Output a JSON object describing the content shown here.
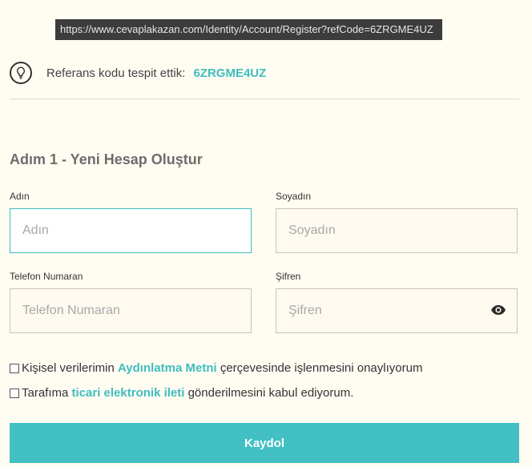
{
  "browser": {
    "url": "https://www.cevaplakazan.com/Identity/Account/Register?refCode=6ZRGME4UZ"
  },
  "referral": {
    "label": "Referans kodu tespit ettik:",
    "code": "6ZRGME4UZ",
    "icon": "lightbulb-icon"
  },
  "form": {
    "step_title": "Adım 1 - Yeni Hesap Oluştur",
    "first_name": {
      "label": "Adın",
      "placeholder": "Adın",
      "value": ""
    },
    "last_name": {
      "label": "Soyadın",
      "placeholder": "Soyadın",
      "value": ""
    },
    "phone": {
      "label": "Telefon Numaran",
      "placeholder": "Telefon Numaran",
      "value": ""
    },
    "password": {
      "label": "Şifren",
      "placeholder": "Şifren",
      "value": "",
      "toggle_icon": "eye-icon"
    },
    "consent_kvkk": {
      "checked": false,
      "text_before": "Kişisel verilerimin ",
      "link": "Aydınlatma Metni",
      "text_after": " çerçevesinde işlenmesini onaylıyorum"
    },
    "consent_marketing": {
      "checked": false,
      "text_before": "Tarafıma ",
      "link": "ticari elektronik ileti",
      "text_after": " gönderilmesini kabul ediyorum."
    },
    "submit_label": "Kaydol"
  },
  "colors": {
    "accent": "#43c0c3",
    "background": "#fffcf2"
  }
}
